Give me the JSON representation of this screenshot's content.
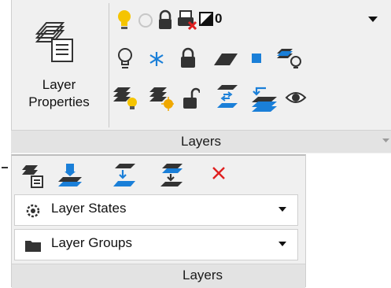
{
  "ribbon": {
    "big_button": {
      "label_line1": "Layer",
      "label_line2": "Properties"
    },
    "current_layer": {
      "name": "0"
    },
    "panel_title": "Layers",
    "icons_row1": [
      "layer-off-icon",
      "layer-isolate-icon",
      "layer-lock-icon",
      "layer-match-icon",
      "layer-current-icon",
      "layer-unisolate-icon"
    ],
    "icons_row2": [
      "layer-on-all-icon",
      "layer-thaw-all-icon",
      "layer-unlock-icon",
      "layer-change-to-current-icon",
      "layer-previous-icon",
      "layer-walk-icon"
    ]
  },
  "expanded": {
    "panel_title": "Layers",
    "tools": [
      "layer-merge-icon",
      "layer-delete-icon",
      "copy-objects-to-layer-icon",
      "layer-translate-icon",
      "delete-x-icon"
    ],
    "layer_states": {
      "label": "Layer States"
    },
    "layer_groups": {
      "label": "Layer Groups"
    }
  },
  "colors": {
    "accent_blue": "#1a7fd8",
    "bulb_yellow": "#f5c400",
    "delete_red": "#e02020"
  }
}
